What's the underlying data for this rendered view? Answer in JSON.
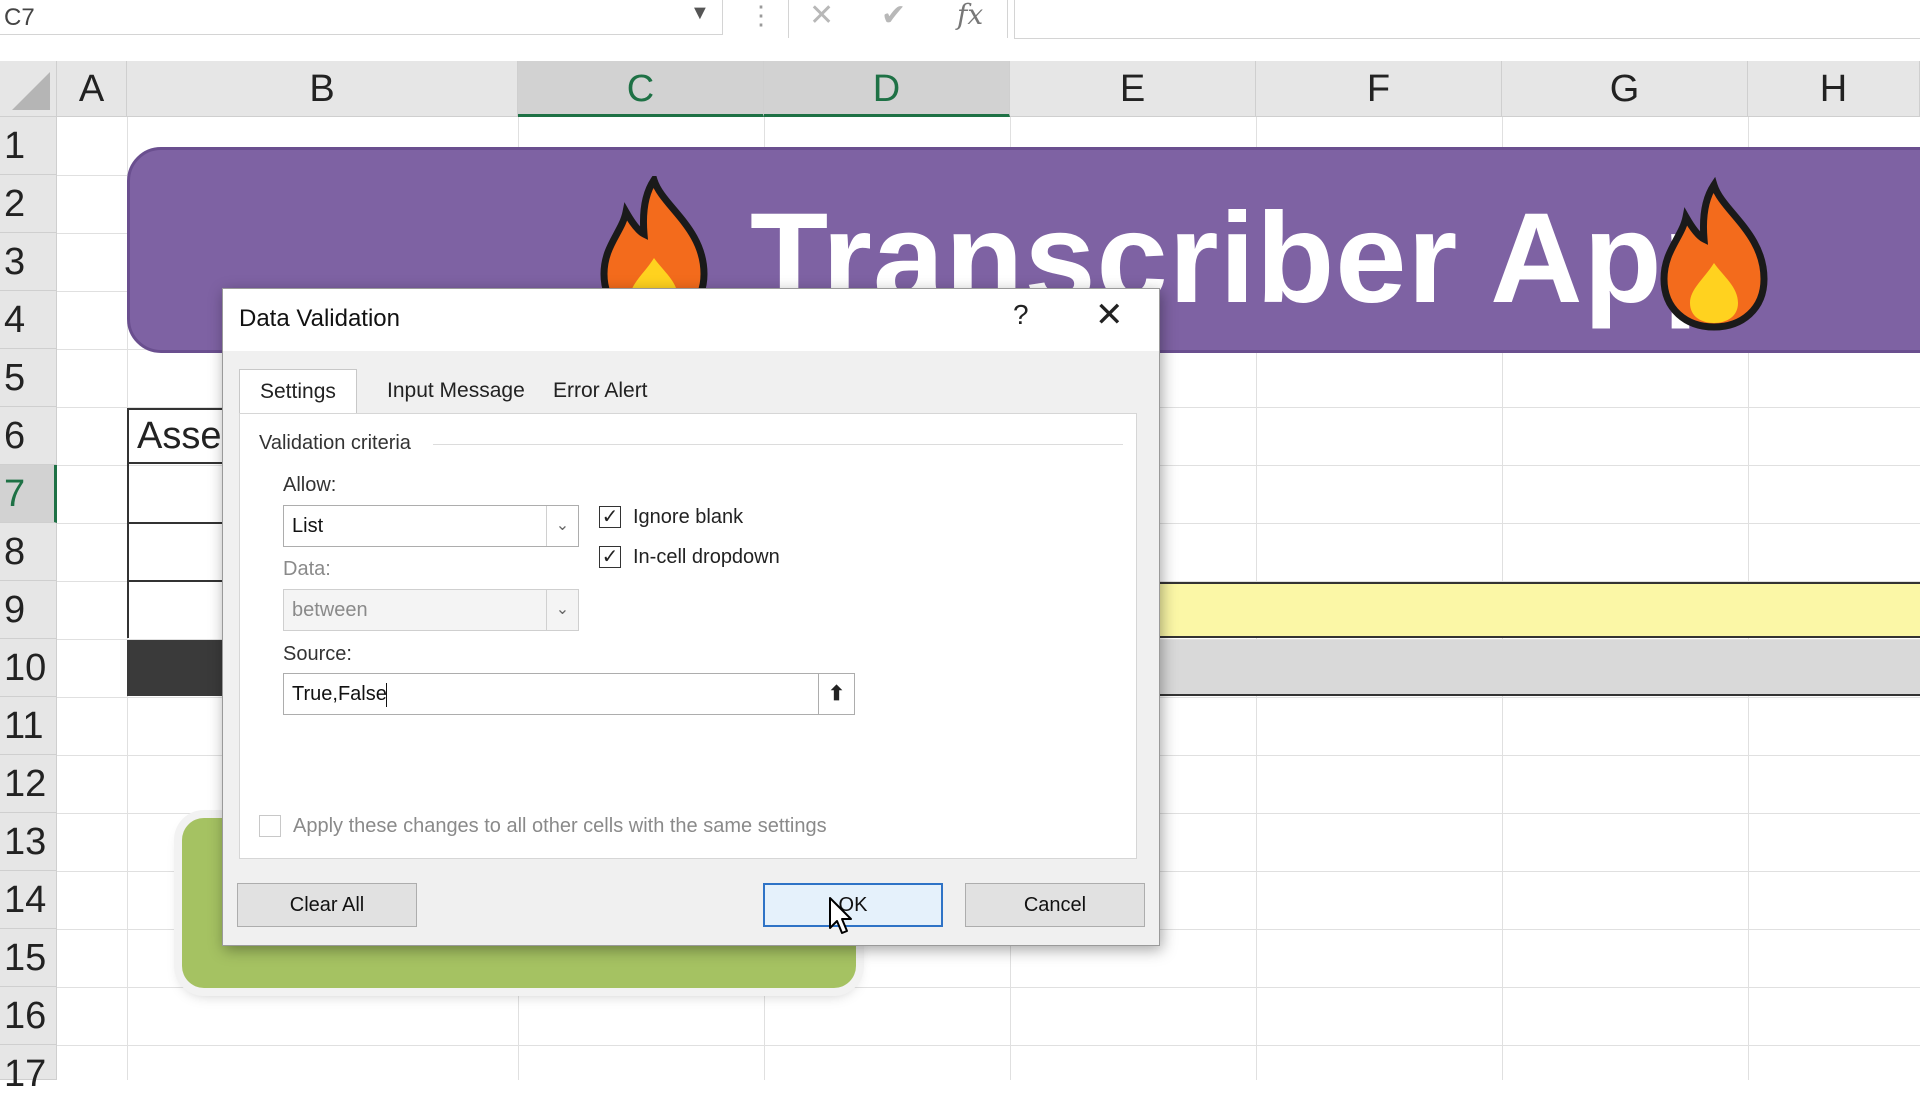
{
  "formula_bar": {
    "name_box": "C7",
    "cancel_icon": "x-icon",
    "enter_icon": "check-icon",
    "function_label": "fx",
    "formula": ""
  },
  "columns": [
    "A",
    "B",
    "C",
    "D",
    "E",
    "F",
    "G",
    "H"
  ],
  "selected_columns": [
    "C",
    "D"
  ],
  "rows": [
    "1",
    "2",
    "3",
    "4",
    "5",
    "6",
    "7",
    "8",
    "9",
    "10",
    "11",
    "12",
    "13",
    "14",
    "15",
    "16",
    "17"
  ],
  "selected_row": "7",
  "sheet": {
    "banner_title": "Transcriber App",
    "banner_icon": "fire-emoji",
    "b6_text": "Asse",
    "colors": {
      "banner": "#7e62a3",
      "yellow_row": "#fbf7a6",
      "gray_row": "#d9d9d9",
      "green_button": "#a5c262"
    }
  },
  "dialog": {
    "title": "Data Validation",
    "help": "?",
    "close_icon": "close-icon",
    "tabs": [
      {
        "label": "Settings",
        "active": true
      },
      {
        "label": "Input Message",
        "active": false
      },
      {
        "label": "Error Alert",
        "active": false
      }
    ],
    "group_label": "Validation criteria",
    "allow": {
      "label": "Allow:",
      "value": "List"
    },
    "data": {
      "label": "Data:",
      "value": "between",
      "disabled": true
    },
    "ignore_blank": {
      "label": "Ignore blank",
      "checked": true
    },
    "in_cell_dropdown": {
      "label": "In-cell dropdown",
      "checked": true
    },
    "source": {
      "label": "Source:",
      "value": "True,False"
    },
    "apply_all": {
      "label": "Apply these changes to all other cells with the same settings",
      "checked": false,
      "disabled": true
    },
    "buttons": {
      "clear_all": "Clear All",
      "ok": "OK",
      "cancel": "Cancel"
    }
  }
}
